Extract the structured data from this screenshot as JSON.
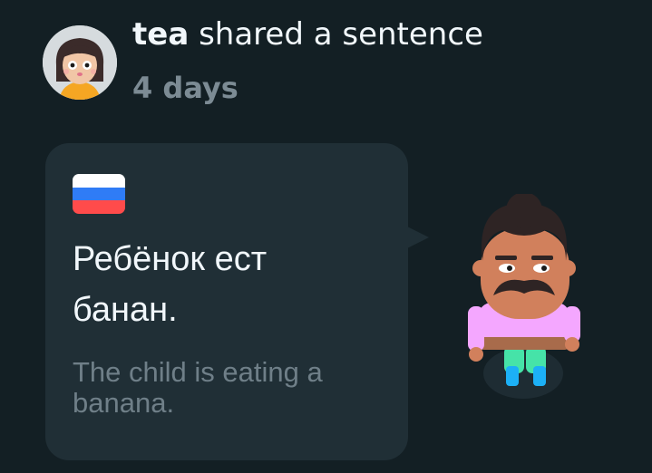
{
  "header": {
    "username": "tea",
    "action_text": " shared a sentence",
    "timestamp": "4 days"
  },
  "card": {
    "flag_icon": "russia-flag-icon",
    "sentence": "Ребёнок ест банан.",
    "translation": "The child is eating a banana."
  },
  "colors": {
    "background": "#131f24",
    "card_background": "#202f36",
    "primary_text": "#f1f7fb",
    "secondary_text": "#7c8b94"
  }
}
